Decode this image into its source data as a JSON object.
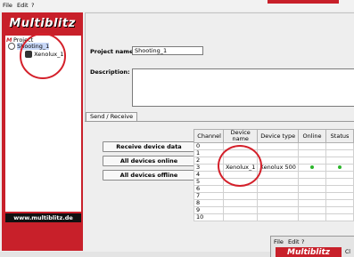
{
  "menu": {
    "file": "File",
    "edit": "Edit",
    "help": "?"
  },
  "sidebar": {
    "logo": "Multiblitz",
    "tree": {
      "root_badge": "M",
      "root": "Project",
      "project": "Shooting_1",
      "device": "Xenolux_1"
    },
    "url": "www.multiblitz.de"
  },
  "project": {
    "name_label": "Project name:",
    "name_value": "Shooting_1",
    "description_label": "Description:",
    "description_value": ""
  },
  "tabs": {
    "send_receive": "Send / Receive"
  },
  "buttons": {
    "receive": "Receive device data",
    "all_online": "All devices online",
    "all_offline": "All devices offline"
  },
  "table": {
    "columns": [
      "Channel",
      "Device name",
      "Device type",
      "Online",
      "Status"
    ],
    "rows": [
      {
        "channel": "0",
        "name": "",
        "type": "",
        "online": false,
        "status": false
      },
      {
        "channel": "1",
        "name": "",
        "type": "",
        "online": false,
        "status": false
      },
      {
        "channel": "2",
        "name": "",
        "type": "",
        "online": false,
        "status": false
      },
      {
        "channel": "3",
        "name": "Xenolux_1",
        "type": "Xenolux 500",
        "online": true,
        "status": true
      },
      {
        "channel": "4",
        "name": "",
        "type": "",
        "online": false,
        "status": false
      },
      {
        "channel": "5",
        "name": "",
        "type": "",
        "online": false,
        "status": false
      },
      {
        "channel": "6",
        "name": "",
        "type": "",
        "online": false,
        "status": false
      },
      {
        "channel": "7",
        "name": "",
        "type": "",
        "online": false,
        "status": false
      },
      {
        "channel": "8",
        "name": "",
        "type": "",
        "online": false,
        "status": false
      },
      {
        "channel": "9",
        "name": "",
        "type": "",
        "online": false,
        "status": false
      },
      {
        "channel": "10",
        "name": "",
        "type": "",
        "online": false,
        "status": false
      }
    ]
  },
  "overlay_window": {
    "menu": {
      "file": "File",
      "edit": "Edit",
      "help": "?"
    },
    "logo": "Multiblitz",
    "partial_text": "Cl"
  },
  "colors": {
    "brand_red": "#c8202a",
    "online_green": "#2cb52c",
    "annotation_red": "#d4202a"
  }
}
